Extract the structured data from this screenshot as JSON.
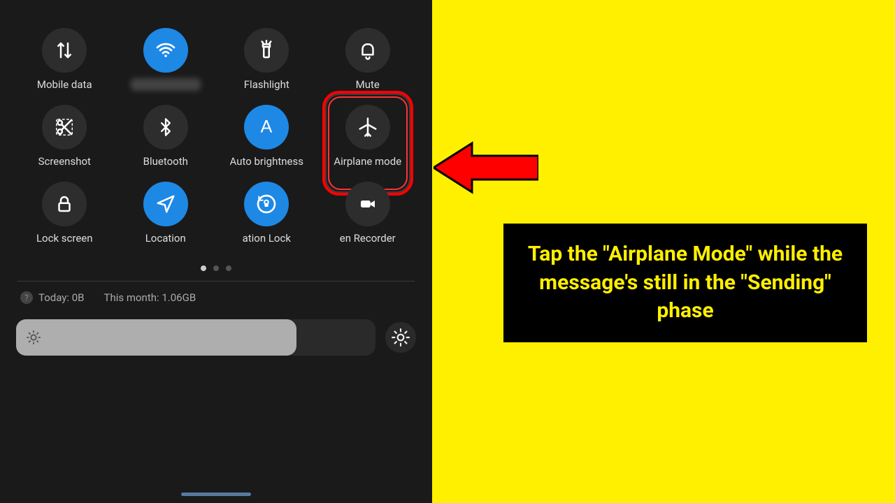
{
  "tiles": [
    {
      "name": "mobile-data",
      "label": "Mobile data",
      "active": false,
      "icon": "arrows"
    },
    {
      "name": "wifi",
      "label": "",
      "active": true,
      "icon": "wifi",
      "blurred_label": true
    },
    {
      "name": "flashlight",
      "label": "Flashlight",
      "active": false,
      "icon": "torch"
    },
    {
      "name": "mute",
      "label": "Mute",
      "active": false,
      "icon": "bell"
    },
    {
      "name": "screenshot",
      "label": "Screenshot",
      "active": false,
      "icon": "scissors"
    },
    {
      "name": "bluetooth",
      "label": "Bluetooth",
      "active": false,
      "icon": "bluetooth"
    },
    {
      "name": "auto-bright",
      "label": "Auto brightness",
      "active": true,
      "icon": "letterA"
    },
    {
      "name": "airplane",
      "label": "Airplane mode",
      "active": false,
      "icon": "plane",
      "highlight": true
    },
    {
      "name": "lock-screen",
      "label": "Lock screen",
      "active": false,
      "icon": "lock"
    },
    {
      "name": "location",
      "label": "Location",
      "active": true,
      "icon": "nav"
    },
    {
      "name": "rotation",
      "label": "ation Lock",
      "active": true,
      "icon": "rotlock"
    },
    {
      "name": "recorder",
      "label": "en Recorder",
      "active": false,
      "icon": "camera"
    }
  ],
  "usage": {
    "today_label": "Today: 0B",
    "month_label": "This month: 1.06GB"
  },
  "brightness_percent": 78,
  "page_indicator": {
    "total": 3,
    "active": 0
  },
  "instruction": "Tap the \"Airplane Mode\" while the message's still in the \"Sending\" phase",
  "colors": {
    "accent": "#1e88e5",
    "highlight": "#ff0000",
    "bg_yellow": "#fff000"
  }
}
